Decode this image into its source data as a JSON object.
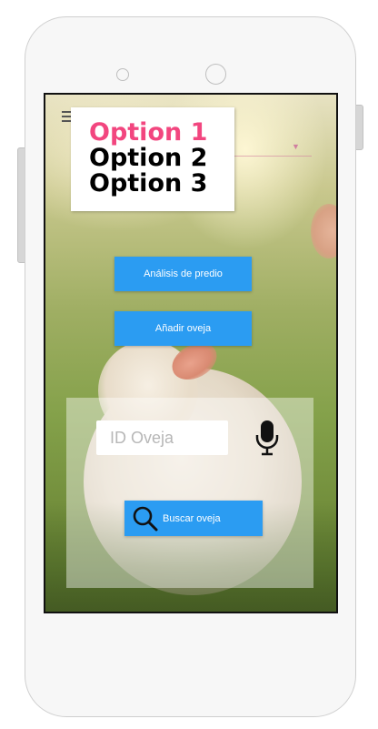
{
  "nav": {
    "menu_icon": "hamburger-icon",
    "dropdown_options": [
      "Option 1",
      "Option 2",
      "Option 3"
    ],
    "selected_option": "Option 1",
    "caret_icon": "chevron-down-icon"
  },
  "actions": {
    "predio_label": "Análisis de predio",
    "anadir_label": "Añadir oveja"
  },
  "search": {
    "placeholder": "ID Oveja",
    "value": "",
    "mic_icon": "microphone-icon",
    "button_label": "Buscar oveja",
    "button_icon": "search-icon"
  },
  "colors": {
    "primary_button": "#2b9cf2",
    "selected_option": "#f2467f"
  }
}
